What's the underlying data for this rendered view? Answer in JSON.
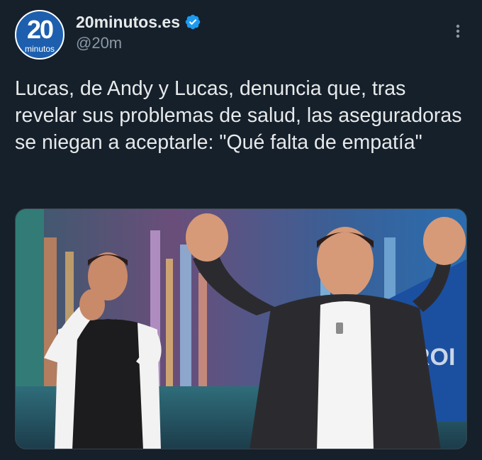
{
  "account": {
    "display_name": "20minutos.es",
    "handle": "@20m",
    "avatar": {
      "big": "20",
      "small": "minutos"
    },
    "verified_icon": "verified-badge-icon"
  },
  "tweet": {
    "text": "Lucas, de Andy y Lucas, denuncia que, tras revelar sus problemas de salud, las aseguradoras se niegan a aceptarle: \"Qué falta de empatía\""
  },
  "media": {
    "description_icon": "photo"
  },
  "colors": {
    "background": "#15202b",
    "text": "#e7e9ea",
    "muted": "#8b98a5",
    "verified": "#1d9bf0"
  }
}
